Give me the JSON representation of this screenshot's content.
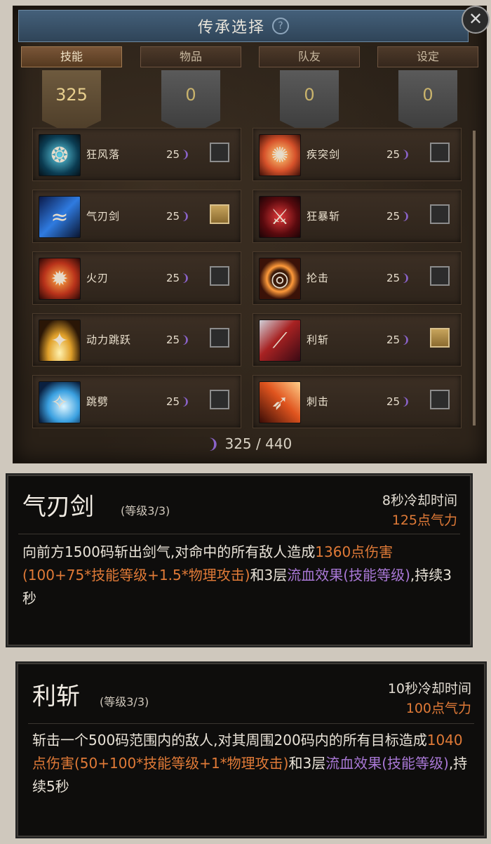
{
  "panel": {
    "title": "传承选择",
    "help_icon": "?",
    "close_icon": "✕",
    "tabs": [
      "技能",
      "物品",
      "队友",
      "设定"
    ],
    "active_tab": "技能",
    "banners": [
      "325",
      "0",
      "0",
      "0"
    ],
    "skills": [
      {
        "name": "狂风落",
        "cost": "25",
        "checked": false,
        "icon": "whirl-icon"
      },
      {
        "name": "疾突剑",
        "cost": "25",
        "checked": false,
        "icon": "burst-icon"
      },
      {
        "name": "气刃剑",
        "cost": "25",
        "checked": true,
        "icon": "blade-wind-icon"
      },
      {
        "name": "狂暴斩",
        "cost": "25",
        "checked": false,
        "icon": "frenzy-slash-icon"
      },
      {
        "name": "火刃",
        "cost": "25",
        "checked": false,
        "icon": "fire-blade-icon"
      },
      {
        "name": "抡击",
        "cost": "25",
        "checked": false,
        "icon": "swing-icon"
      },
      {
        "name": "动力跳跃",
        "cost": "25",
        "checked": false,
        "icon": "power-jump-icon"
      },
      {
        "name": "利斩",
        "cost": "25",
        "checked": true,
        "icon": "sharp-slash-icon"
      },
      {
        "name": "跳劈",
        "cost": "25",
        "checked": false,
        "icon": "jump-cleave-icon"
      },
      {
        "name": "刺击",
        "cost": "25",
        "checked": false,
        "icon": "stab-icon"
      }
    ],
    "total": "325 / 440"
  },
  "tooltips": [
    {
      "name": "气刃剑",
      "level": "(等级3/3)",
      "cooldown": "8秒冷却时间",
      "cost": "125点气力",
      "desc_parts": [
        {
          "text": "向前方1500码斩出剑气,对命中的所有敌人造成",
          "style": "normal"
        },
        {
          "text": "1360点伤害(100+75*技能等级+1.5*物理攻击)",
          "style": "dmg"
        },
        {
          "text": "和3层",
          "style": "normal"
        },
        {
          "text": "流血效果(技能等级)",
          "style": "bleed"
        },
        {
          "text": ",持续3秒",
          "style": "normal"
        }
      ]
    },
    {
      "name": "利斩",
      "level": "(等级3/3)",
      "cooldown": "10秒冷却时间",
      "cost": "100点气力",
      "desc_parts": [
        {
          "text": "斩击一个500码范围内的敌人,对其周围200码内的所有目标造成",
          "style": "normal"
        },
        {
          "text": "1040点伤害(50+100*技能等级+1*物理攻击)",
          "style": "dmg"
        },
        {
          "text": "和3层",
          "style": "normal"
        },
        {
          "text": "流血效果(技能等级)",
          "style": "bleed"
        },
        {
          "text": ",持续5秒",
          "style": "normal"
        }
      ]
    }
  ],
  "colors": {
    "accent_gold": "#c7a45c",
    "damage_orange": "#e07a37",
    "bleed_purple": "#a978d6",
    "qi_purple": "#8a63c9"
  }
}
